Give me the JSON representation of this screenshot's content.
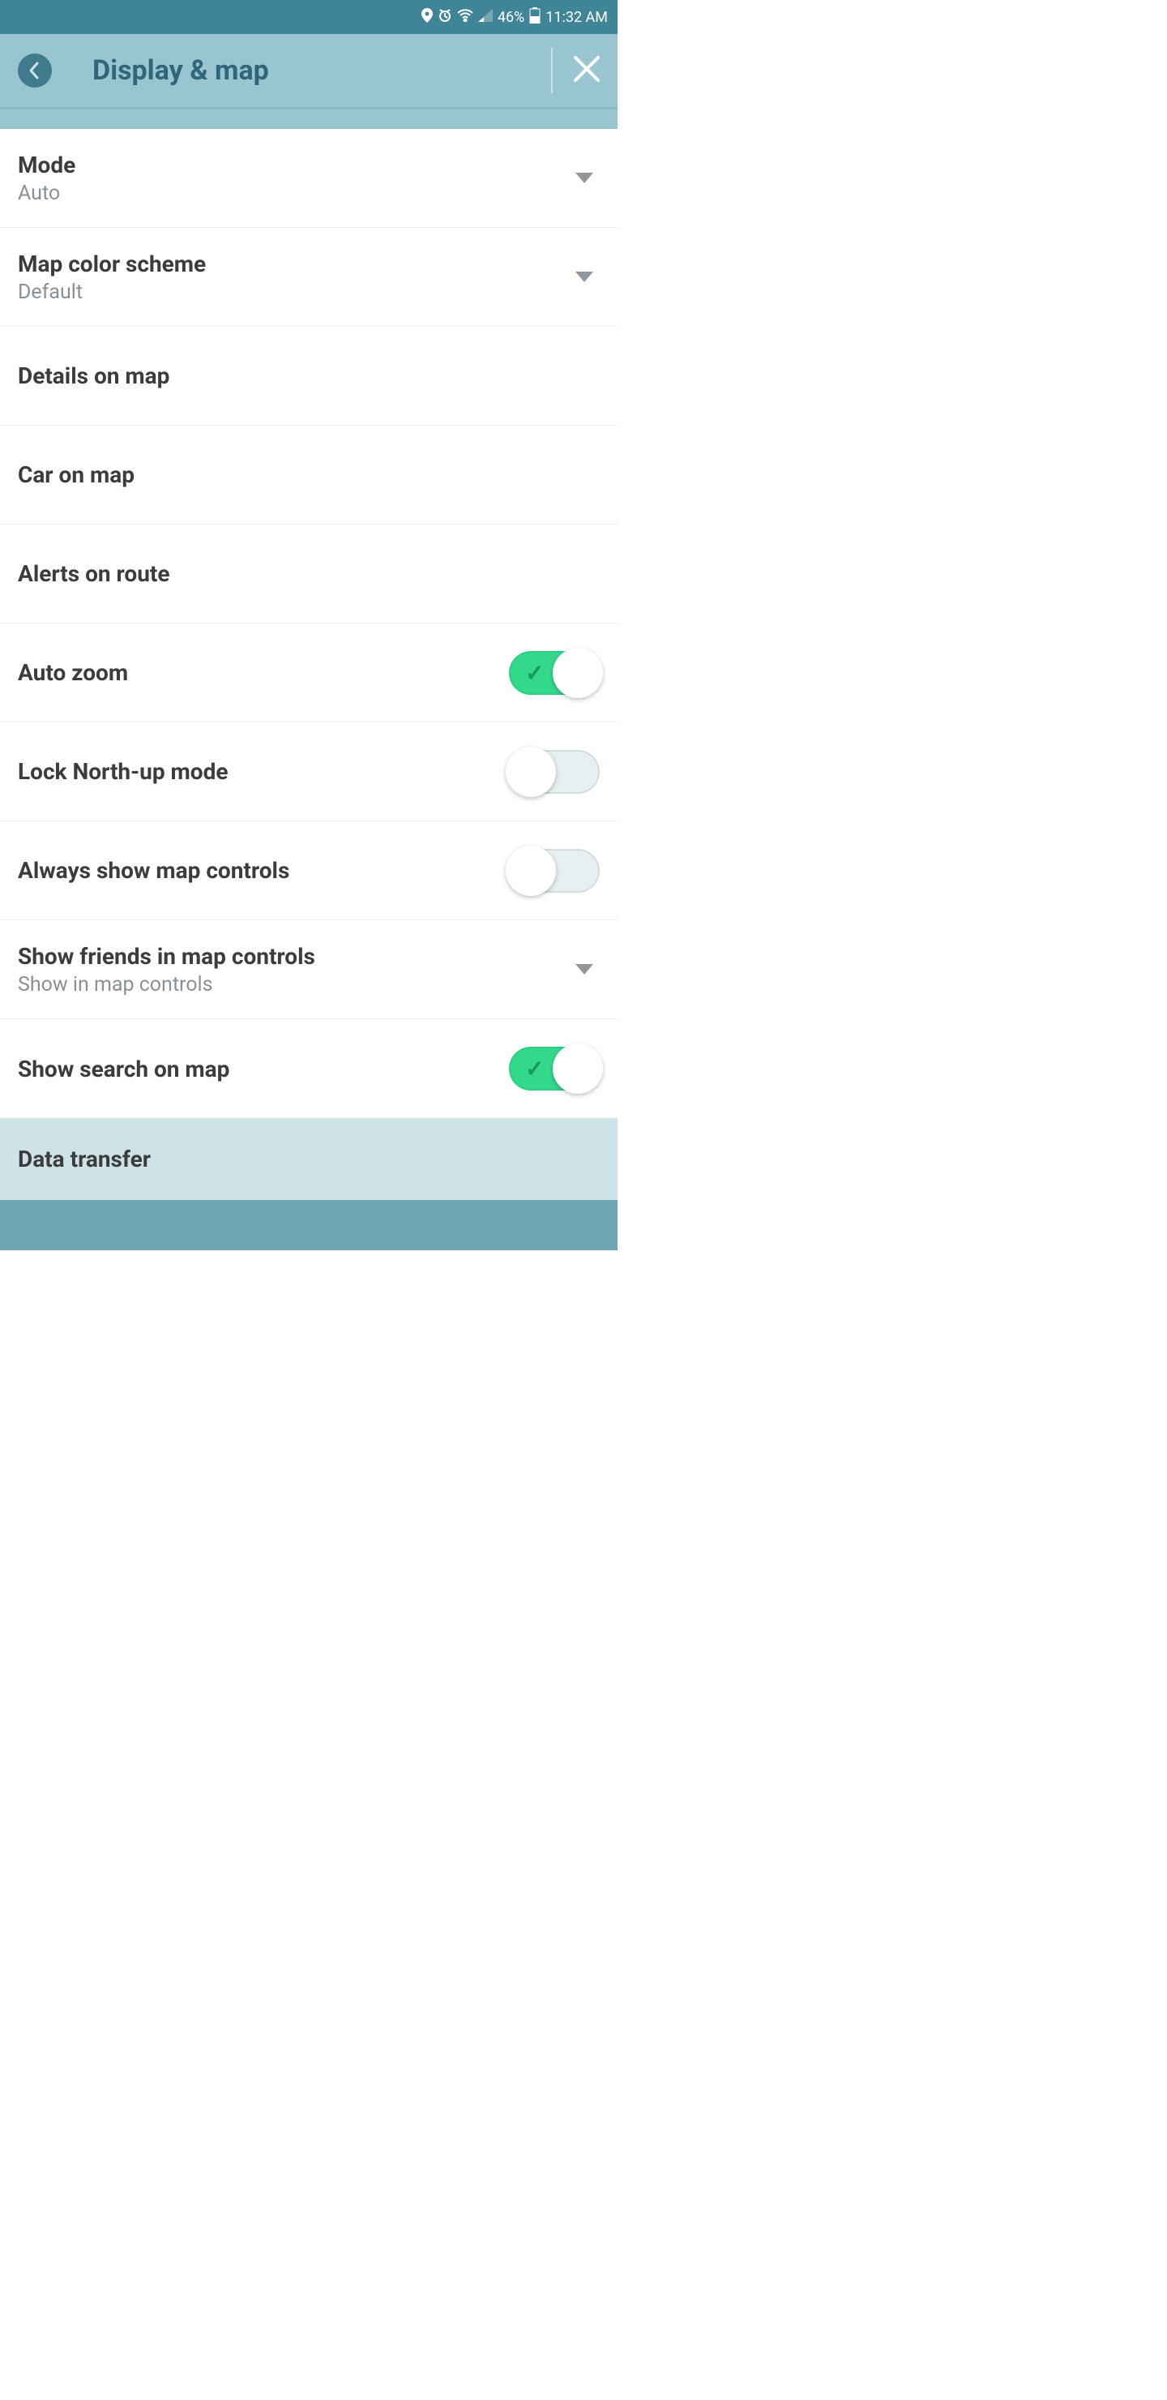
{
  "status": {
    "battery": "46%",
    "time": "11:32 AM"
  },
  "header": {
    "title": "Display & map"
  },
  "settings": {
    "mode": {
      "label": "Mode",
      "value": "Auto"
    },
    "color_scheme": {
      "label": "Map color scheme",
      "value": "Default"
    },
    "details": {
      "label": "Details on map"
    },
    "car": {
      "label": "Car on map"
    },
    "alerts": {
      "label": "Alerts on route"
    },
    "auto_zoom": {
      "label": "Auto zoom"
    },
    "lock_north": {
      "label": "Lock North-up mode"
    },
    "always_controls": {
      "label": "Always show map controls"
    },
    "friends": {
      "label": "Show friends in map controls",
      "value": "Show in map controls"
    },
    "search_map": {
      "label": "Show search on map"
    }
  },
  "section": {
    "data_transfer": "Data transfer"
  }
}
